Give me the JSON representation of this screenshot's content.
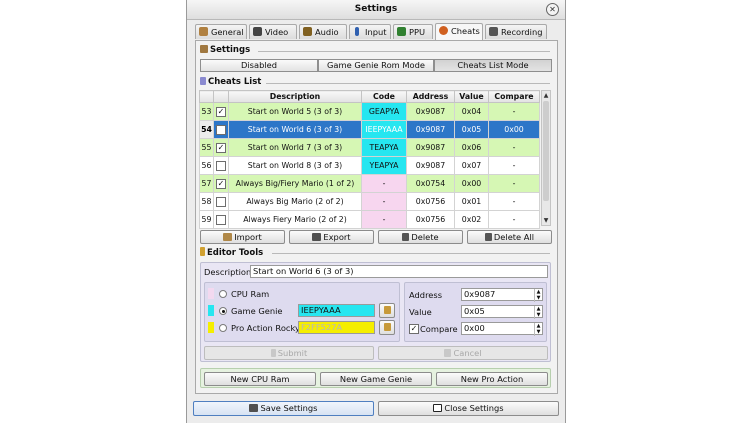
{
  "window": {
    "title": "Settings"
  },
  "tabs": [
    {
      "label": "General",
      "icon": "wrench-icon",
      "color": "#b08040"
    },
    {
      "label": "Video",
      "icon": "monitor-icon",
      "color": "#444444"
    },
    {
      "label": "Audio",
      "icon": "speaker-icon",
      "color": "#806020"
    },
    {
      "label": "Input",
      "icon": "joystick-icon",
      "color": "#3060b0"
    },
    {
      "label": "PPU",
      "icon": "chip-icon",
      "color": "#308030"
    },
    {
      "label": "Cheats",
      "icon": "cheats-icon",
      "color": "#d06020",
      "active": true
    },
    {
      "label": "Recording",
      "icon": "film-icon",
      "color": "#555555"
    }
  ],
  "settings_section": {
    "title": "Settings",
    "modes": [
      {
        "label": "Disabled",
        "active": false
      },
      {
        "label": "Game Genie Rom Mode",
        "active": false
      },
      {
        "label": "Cheats List Mode",
        "active": true
      }
    ]
  },
  "cheats_list": {
    "title": "Cheats List",
    "columns": [
      "Description",
      "Code",
      "Address",
      "Value",
      "Compare"
    ],
    "rows": [
      {
        "num": "53",
        "checked": true,
        "desc": "Start on World 5 (3 of 3)",
        "code": "GEAPYA",
        "address": "0x9087",
        "value": "0x04",
        "compare": "-",
        "style": "green",
        "codetype": "gg"
      },
      {
        "num": "54",
        "checked": false,
        "desc": "Start on World 6 (3 of 3)",
        "code": "IEEPYAAA",
        "address": "0x9087",
        "value": "0x05",
        "compare": "0x00",
        "style": "sel",
        "codetype": "gg"
      },
      {
        "num": "55",
        "checked": true,
        "desc": "Start on World 7 (3 of 3)",
        "code": "TEAPYA",
        "address": "0x9087",
        "value": "0x06",
        "compare": "-",
        "style": "green",
        "codetype": "gg"
      },
      {
        "num": "56",
        "checked": false,
        "desc": "Start on World 8 (3 of 3)",
        "code": "YEAPYA",
        "address": "0x9087",
        "value": "0x07",
        "compare": "-",
        "style": "white",
        "codetype": "gg"
      },
      {
        "num": "57",
        "checked": true,
        "desc": "Always Big/Fiery Mario (1 of 2)",
        "code": "-",
        "address": "0x0754",
        "value": "0x00",
        "compare": "-",
        "style": "green",
        "codetype": "pac"
      },
      {
        "num": "58",
        "checked": false,
        "desc": "Always Big Mario (2 of 2)",
        "code": "-",
        "address": "0x0756",
        "value": "0x01",
        "compare": "-",
        "style": "white",
        "codetype": "pac"
      },
      {
        "num": "59",
        "checked": false,
        "desc": "Always Fiery Mario (2 of 2)",
        "code": "-",
        "address": "0x0756",
        "value": "0x02",
        "compare": "-",
        "style": "white",
        "codetype": "pac"
      }
    ]
  },
  "list_buttons": {
    "import": "Import",
    "export": "Export",
    "delete": "Delete",
    "delete_all": "Delete All"
  },
  "editor": {
    "title": "Editor Tools",
    "description_label": "Description",
    "description_value": "Start on World 6 (3 of 3)",
    "types": [
      {
        "label": "CPU Ram",
        "selected": false,
        "color": "#f3d9f0"
      },
      {
        "label": "Game Genie",
        "selected": true,
        "color": "#26e6f0"
      },
      {
        "label": "Pro Action Rocky",
        "selected": false,
        "color": "#f5ee00"
      }
    ],
    "game_genie_code": "IEEPYAAA",
    "pro_action_code": "F2FF527A",
    "address_label": "Address",
    "address_value": "0x9087",
    "value_label": "Value",
    "value_value": "0x05",
    "compare_label": "Compare",
    "compare_checked": true,
    "compare_value": "0x00",
    "submit_label": "Submit",
    "cancel_label": "Cancel"
  },
  "new_buttons": {
    "cpu_ram": "New CPU Ram",
    "game_genie": "New Game Genie",
    "pro_action": "New Pro Action"
  },
  "footer": {
    "save": "Save Settings",
    "close": "Close Settings"
  }
}
